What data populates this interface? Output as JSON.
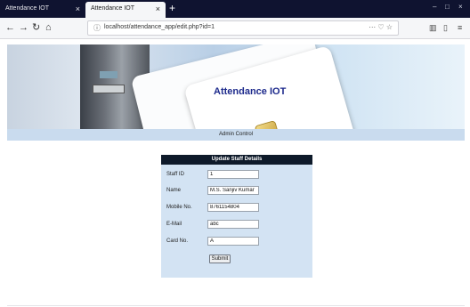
{
  "browser": {
    "tabs": [
      {
        "title": "Attendance IOT",
        "close": "×"
      },
      {
        "title": "Attendance IOT",
        "close": "×"
      }
    ],
    "new_tab": "+",
    "window_controls": {
      "minimize": "–",
      "maximize": "□",
      "close": "×"
    },
    "nav": {
      "back": "←",
      "forward": "→",
      "reload": "↻",
      "home": "⌂"
    },
    "url": "localhost/attendance_app/edit.php?id=1",
    "url_actions": "··· ♡ ☆",
    "toolbar_icons": {
      "library": "▥",
      "sidebar": "▯",
      "menu": "≡"
    }
  },
  "banner": {
    "title": "Attendance IOT"
  },
  "admin_bar": {
    "label": "Admin Control"
  },
  "form": {
    "heading": "Update Staff Details",
    "fields": [
      {
        "label": "Staff ID",
        "value": "1"
      },
      {
        "label": "Name",
        "value": "M.S. Sanjiv Kumar"
      },
      {
        "label": "Mobile No.",
        "value": "8761154804"
      },
      {
        "label": "E-Mail",
        "value": "abc"
      },
      {
        "label": "Card No.",
        "value": "A"
      }
    ],
    "submit_label": "Submit"
  }
}
